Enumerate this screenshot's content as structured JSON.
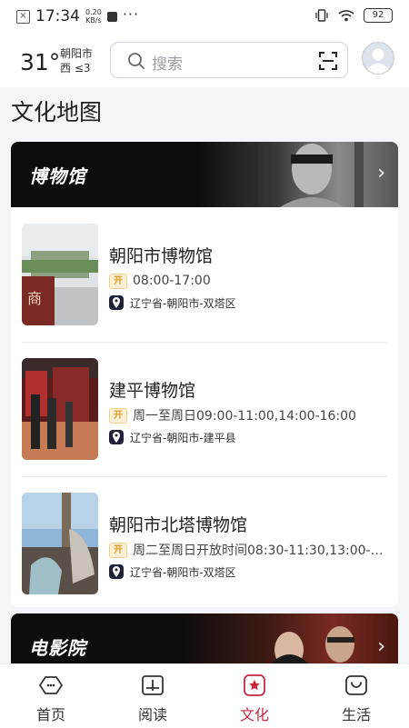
{
  "status_bar": {
    "time": "17:34",
    "net_speed_value": "0.20",
    "net_speed_unit": "KB/s",
    "more": "···",
    "battery": "92"
  },
  "weather": {
    "temperature": "31°",
    "city": "朝阳市",
    "wind": "西 ≤3"
  },
  "search": {
    "placeholder": "搜索"
  },
  "page": {
    "title": "文化地图"
  },
  "museum_section": {
    "title": "博物馆",
    "items": [
      {
        "name": "朝阳市博物馆",
        "hours": "08:00-17:00",
        "address": "辽宁省-朝阳市-双塔区"
      },
      {
        "name": "建平博物馆",
        "hours": "周一至周日09:00-11:00,14:00-16:00",
        "address": "辽宁省-朝阳市-建平县"
      },
      {
        "name": "朝阳市北塔博物馆",
        "hours": "周二至周日开放时间08:30-11:30,13:00-…",
        "address": "辽宁省-朝阳市-双塔区"
      }
    ]
  },
  "cinema_section": {
    "title": "电影院"
  },
  "tabs": [
    {
      "label": "首页",
      "icon": "home-icon",
      "active": false
    },
    {
      "label": "阅读",
      "icon": "book-icon",
      "active": false
    },
    {
      "label": "文化",
      "icon": "culture-icon",
      "active": true
    },
    {
      "label": "生活",
      "icon": "life-bag-icon",
      "active": false
    }
  ],
  "colors": {
    "accent": "#c8283f",
    "badge_orange": "#e39a1b",
    "pin_navy": "#1d2238"
  }
}
